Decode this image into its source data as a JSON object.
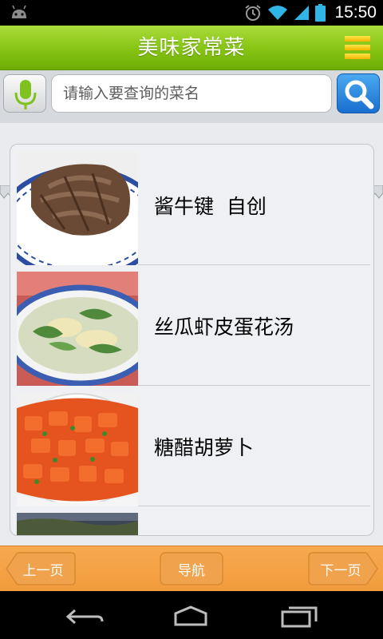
{
  "status_bar": {
    "time": "15:50",
    "icons": [
      "android-debug-icon",
      "alarm-icon",
      "wifi-icon",
      "signal-icon",
      "battery-icon"
    ]
  },
  "header": {
    "title": "美味家常菜",
    "menu_icon": "menu-icon"
  },
  "search": {
    "placeholder": "请输入要查询的菜名",
    "value": "",
    "mic_icon": "microphone-icon",
    "search_icon": "search-icon"
  },
  "recipes": [
    {
      "name": "酱牛键  自创",
      "image": "sliced-braised-beef-photo"
    },
    {
      "name": "丝瓜虾皮蛋花汤",
      "image": "loofah-egg-soup-photo"
    },
    {
      "name": "糖醋胡萝卜",
      "image": "sweet-sour-carrot-photo"
    },
    {
      "name": "",
      "image": "partial-dish-photo"
    }
  ],
  "bottom_nav": {
    "prev_label": "上一页",
    "nav_label": "导航",
    "next_label": "下一页"
  },
  "colors": {
    "title_bar": "#85c313",
    "bottom_bar": "#f29c3c",
    "search_button": "#1a6fd0"
  }
}
